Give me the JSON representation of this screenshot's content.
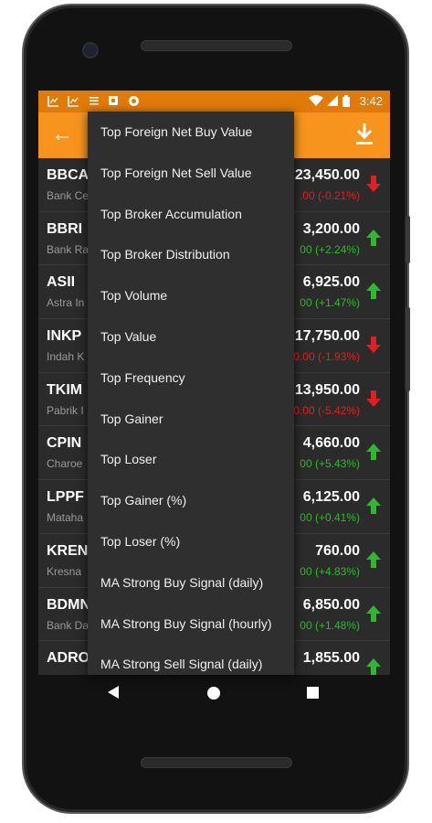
{
  "status_bar": {
    "time": "3:42",
    "icons": [
      "chart-icon",
      "chart-icon",
      "list-icon",
      "app-icon",
      "circle-icon",
      "wifi-icon",
      "signal-icon",
      "battery-icon"
    ]
  },
  "app_bar": {
    "back_icon": "arrow-back-icon",
    "download_icon": "download-icon"
  },
  "colors": {
    "status_bar": "#e07a08",
    "app_bar": "#f7941d",
    "up": "#32b632",
    "down": "#e02020",
    "menu_bg": "#2f2f2f"
  },
  "stocks": [
    {
      "code": "BBCA",
      "name": "Bank Ce",
      "price": "23,450.00",
      "change": ".00 (-0.21%)",
      "direction": "down"
    },
    {
      "code": "BBRI",
      "name": "Bank Ra",
      "price": "3,200.00",
      "change": "00 (+2.24%)",
      "direction": "up"
    },
    {
      "code": "ASII",
      "name": "Astra In",
      "price": "6,925.00",
      "change": "00 (+1.47%)",
      "direction": "up"
    },
    {
      "code": "INKP",
      "name": "Indah K",
      "price": "17,750.00",
      "change": "0.00 (-1.93%)",
      "direction": "down"
    },
    {
      "code": "TKIM",
      "name": "Pabrik I",
      "price": "13,950.00",
      "change": "0.00 (-5.42%)",
      "direction": "down"
    },
    {
      "code": "CPIN",
      "name": "Charoe",
      "price": "4,660.00",
      "change": "00 (+5.43%)",
      "direction": "up"
    },
    {
      "code": "LPPF",
      "name": "Mataha",
      "price": "6,125.00",
      "change": "00 (+0.41%)",
      "direction": "up"
    },
    {
      "code": "KREN",
      "name": "Kresna",
      "price": "760.00",
      "change": "00 (+4.83%)",
      "direction": "up"
    },
    {
      "code": "BDMN",
      "name": "Bank Da",
      "price": "6,850.00",
      "change": "00 (+1.48%)",
      "direction": "up"
    },
    {
      "code": "ADRO",
      "name": "",
      "price": "1,855.00",
      "change": "",
      "direction": "up"
    }
  ],
  "menu": {
    "items": [
      "Top Foreign Net Buy Value",
      "Top Foreign Net Sell Value",
      "Top Broker Accumulation",
      "Top Broker Distribution",
      "Top Volume",
      "Top Value",
      "Top Frequency",
      "Top Gainer",
      "Top Loser",
      "Top Gainer (%)",
      "Top Loser (%)",
      "MA Strong Buy Signal (daily)",
      "MA Strong Buy Signal (hourly)",
      "MA Strong Sell Signal (daily)"
    ]
  },
  "nav_bar": {
    "icons": [
      "nav-back-icon",
      "nav-home-icon",
      "nav-recents-icon"
    ]
  }
}
